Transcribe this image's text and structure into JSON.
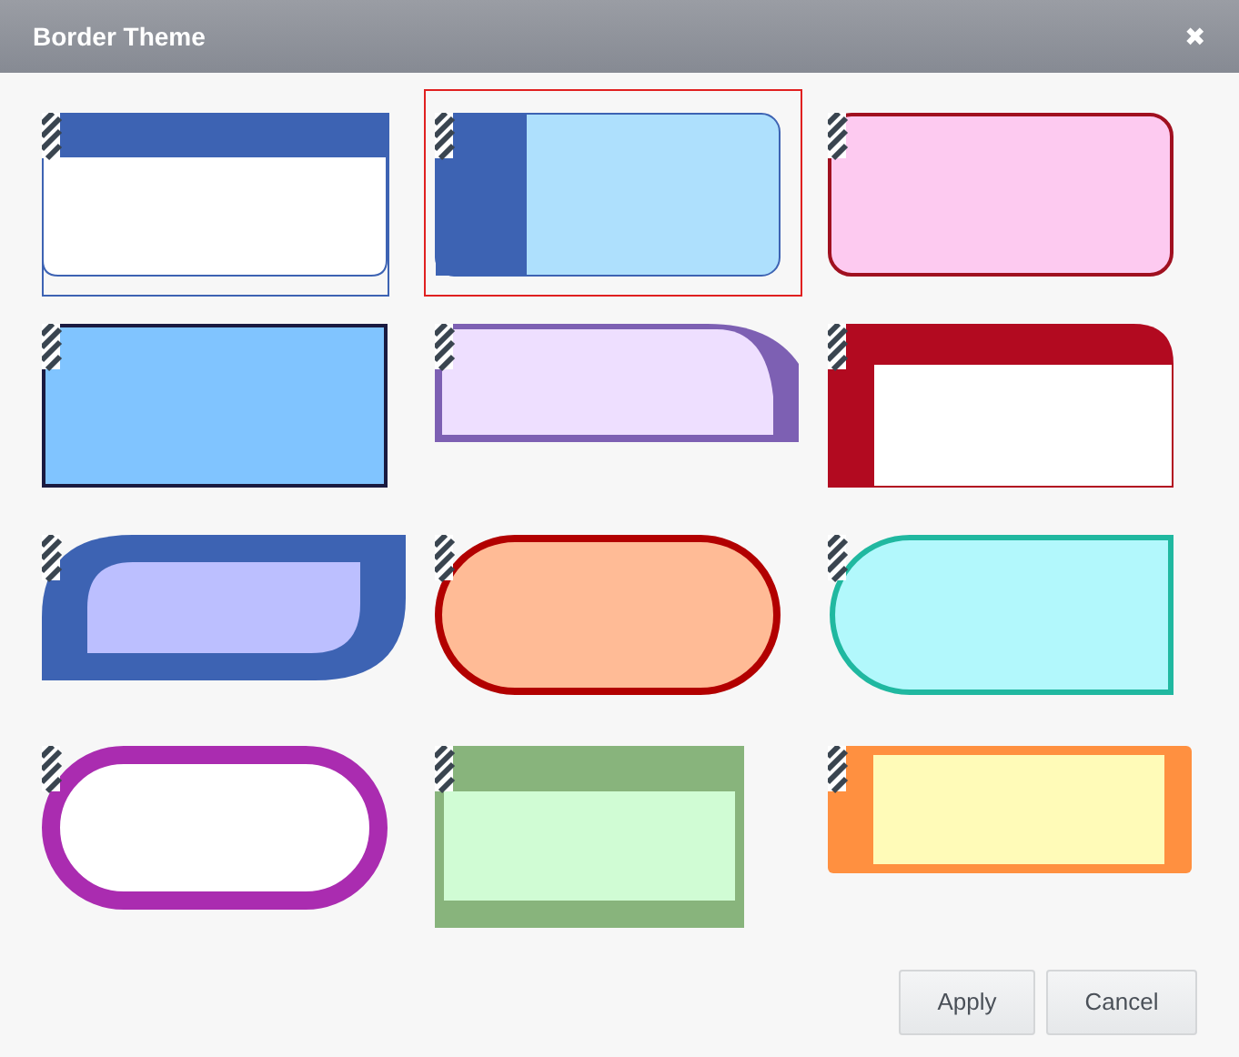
{
  "dialog": {
    "title": "Border Theme",
    "close": "✖"
  },
  "themes": [
    {
      "kind": "header-band",
      "color": "#3d63b3",
      "selected": false
    },
    {
      "kind": "side-band",
      "color": "#3d63b3",
      "selected": true
    },
    {
      "kind": "rounded",
      "color": "#a01020",
      "selected": false
    },
    {
      "kind": "square",
      "color": "#1a1a40",
      "selected": false
    },
    {
      "kind": "folded-corner",
      "color": "#7d60b3",
      "selected": false
    },
    {
      "kind": "corner-tab",
      "color": "#b20a20",
      "selected": false
    },
    {
      "kind": "leaf",
      "color": "#3d63b3",
      "selected": false
    },
    {
      "kind": "pill",
      "color": "#b20000",
      "selected": false
    },
    {
      "kind": "half-pill",
      "color": "#20b8a0",
      "selected": false
    },
    {
      "kind": "ring-pill",
      "color": "#aa2cb0",
      "selected": false
    },
    {
      "kind": "frame-top",
      "color": "#88b47c",
      "selected": false
    },
    {
      "kind": "inset",
      "color": "#ff9040",
      "selected": false
    }
  ],
  "buttons": [
    "Apply",
    "Cancel"
  ]
}
